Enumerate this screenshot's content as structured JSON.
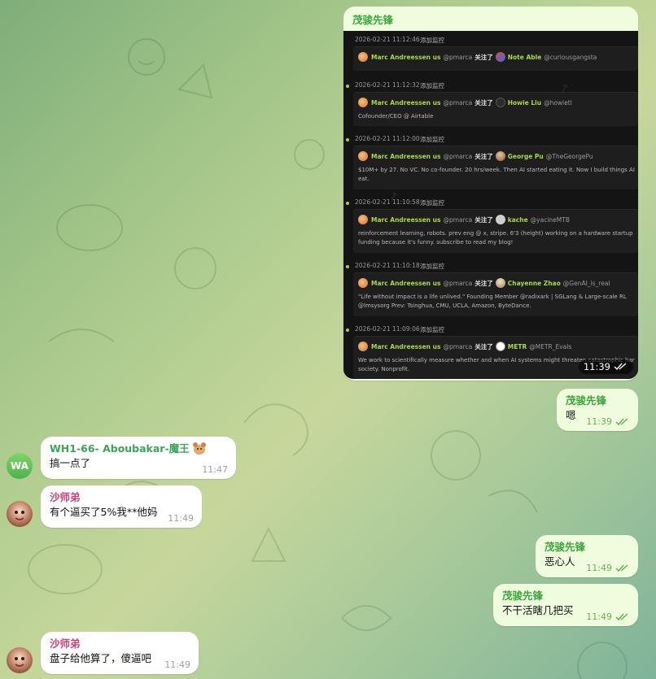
{
  "chat": {
    "card_message": {
      "sender": "茂骏先锋",
      "time": "11:39",
      "entries": [
        {
          "timestamp": "2026-02-21 11:12:46",
          "action_link": "添加监控",
          "actor_name": "Marc Andreessen us",
          "actor_handle": "@pmarca",
          "verb": "关注了",
          "target_name": "Note Able",
          "target_handle": "@curiousgangsta",
          "bio": ""
        },
        {
          "timestamp": "2026-02-21 11:12:32",
          "action_link": "添加监控",
          "actor_name": "Marc Andreessen us",
          "actor_handle": "@pmarca",
          "verb": "关注了",
          "target_name": "Howie Liu",
          "target_handle": "@howietl",
          "bio": "Cofounder/CEO @ Airtable"
        },
        {
          "timestamp": "2026-02-21 11:12:00",
          "action_link": "添加监控",
          "actor_name": "Marc Andreessen us",
          "actor_handle": "@pmarca",
          "verb": "关注了",
          "target_name": "George Pu",
          "target_handle": "@TheGeorgePu",
          "bio": "$10M+ by 27. No VC. No co-founder. 20 hrs/week. Then AI started eating it. Now I build things AI ca",
          "bio2": "eat."
        },
        {
          "timestamp": "2026-02-21 11:10:58",
          "action_link": "添加监控",
          "actor_name": "Marc Andreessen us",
          "actor_handle": "@pmarca",
          "verb": "关注了",
          "target_name": "kache",
          "target_handle": "@yacineMTB",
          "bio": "reinforcement learning, robots. prev eng @ x, stripe. 6'3 (height) working on a hardware startup wit",
          "bio2": "funding because it's funny. subscribe to read my blog!"
        },
        {
          "timestamp": "2026-02-21 11:10:18",
          "action_link": "添加监控",
          "actor_name": "Marc Andreessen us",
          "actor_handle": "@pmarca",
          "verb": "关注了",
          "target_name": "Chayenne Zhao",
          "target_handle": "@GenAI_is_real",
          "bio": "\"Life without impact is a life unlived.\" Founding Member @radixark | SGLang & Large-scale RL",
          "bio2": "@lmsysorg Prev: Tsinghua, CMU, UCLA, Amazon, ByteDance."
        },
        {
          "timestamp": "2026-02-21 11:09:06",
          "action_link": "添加监控",
          "actor_name": "Marc Andreessen us",
          "actor_handle": "@pmarca",
          "verb": "关注了",
          "target_name": "METR",
          "target_handle": "@METR_Evals",
          "bio": "We work to scientifically measure whether and when AI systems might threaten catastrophic harm t",
          "bio2": "society. Nonprofit."
        }
      ]
    },
    "messages": [
      {
        "sender": "茂骏先锋",
        "text": "嗯",
        "time": "11:39"
      },
      {
        "sender": "WH1-66- Aboubakar-魔王",
        "text": "搞一点了",
        "time": "11:47",
        "avatar": "WA"
      },
      {
        "sender": "沙师弟",
        "text": "有个逼买了5%我**他妈",
        "time": "11:49"
      },
      {
        "sender": "茂骏先锋",
        "text": "恶心人",
        "time": "11:49"
      },
      {
        "sender": "茂骏先锋",
        "text": "不干活瞎几把买",
        "time": "11:49"
      },
      {
        "sender": "沙师弟",
        "text": "盘子给他算了，傻逼吧",
        "time": "11:49"
      }
    ]
  },
  "colors": {
    "outgoing_bubble": "#effdde",
    "incoming_bubble": "#ffffff",
    "accent_green": "#a8d84a"
  }
}
